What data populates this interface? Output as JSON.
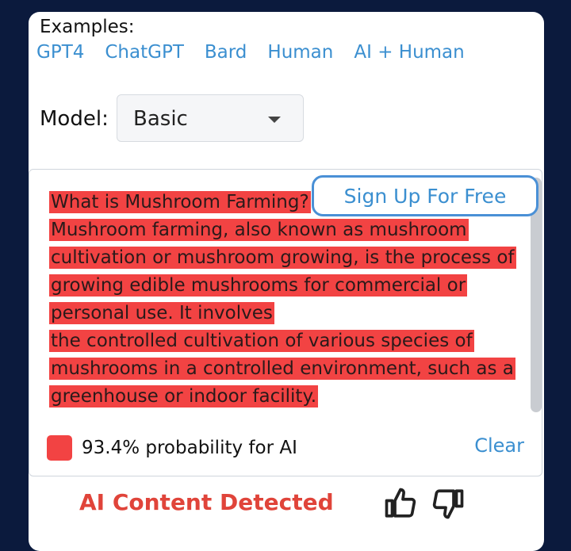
{
  "examples": {
    "label": "Examples:",
    "links": [
      "GPT4",
      "ChatGPT",
      "Bard",
      "Human",
      "AI + Human"
    ]
  },
  "model": {
    "label": "Model:",
    "selected": "Basic"
  },
  "analysis": {
    "paragraphs": [
      "What is Mushroom Farming?",
      "Mushroom farming, also known as mushroom cultivation or mushroom growing, is the process of growing edible mushrooms for commercial or personal use. It involves",
      "the controlled cultivation of various species of mushrooms in a controlled environment, such as a greenhouse or indoor facility."
    ],
    "signup_label": "Sign Up For Free",
    "probability_text": "93.4% probability for AI",
    "clear_label": "Clear"
  },
  "result": {
    "status": "AI Content Detected"
  },
  "colors": {
    "highlight": "#f24343",
    "link": "#3b8fd0",
    "alert": "#e0443a",
    "background": "#0b1a3d"
  },
  "icons": {
    "like": "thumbs-up-icon",
    "dislike": "thumbs-down-icon"
  }
}
